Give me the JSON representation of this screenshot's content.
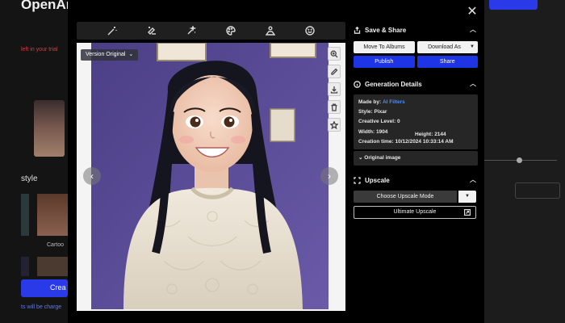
{
  "background": {
    "logo": "OpenArt",
    "hint": "left in your trial",
    "style_heading": "style",
    "cartoon_label": "Cartoo",
    "create_label": "Crea",
    "charge_note": "ts will be charge"
  },
  "viewer": {
    "version_label": "Version Original",
    "toolbar_icons": [
      "magic-wand-icon",
      "edit-erase-icon",
      "sparkle-edit-icon",
      "palette-icon",
      "person-pose-icon",
      "smile-icon"
    ],
    "side_icons": [
      "zoom-in-icon",
      "pencil-icon",
      "download-icon",
      "trash-icon",
      "star-icon"
    ],
    "prev_glyph": "‹",
    "next_glyph": "›",
    "close_glyph": "✕"
  },
  "save_share": {
    "title": "Save & Share",
    "move_label": "Move To Albums",
    "download_label": "Download As",
    "publish_label": "Publish",
    "share_label": "Share"
  },
  "details": {
    "title": "Generation Details",
    "made_by_label": "Made by:",
    "made_by_value": "AI Filters",
    "style_line": "Style: Pixar",
    "creative_line": "Creative Level: 0",
    "width_line": "Width: 1904",
    "height_line": "Height: 2144",
    "creation_line": "Creation time: 10/12/2024 10:33:14 AM",
    "original_label": "Original image"
  },
  "upscale": {
    "title": "Upscale",
    "mode_label": "Choose Upscale Mode",
    "ultimate_label": "Ultimate Upscale"
  },
  "colors": {
    "accent_blue": "#1e35e6",
    "link_blue": "#4a8cff",
    "panel_bg": "#000000"
  }
}
